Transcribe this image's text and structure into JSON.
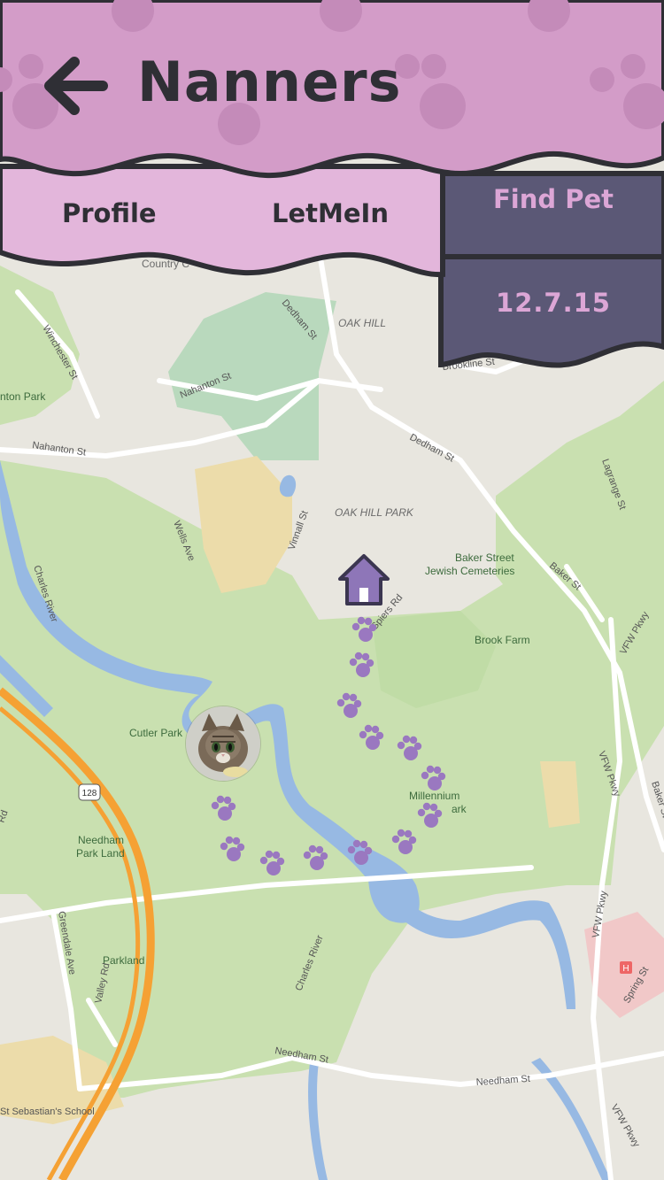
{
  "header": {
    "title": "Nanners",
    "back_icon": "arrow-left-icon",
    "bg_color": "#d39cc8"
  },
  "nav": {
    "tabs": [
      {
        "label": "Profile"
      },
      {
        "label": "LetMeIn"
      },
      {
        "label": "Find Pet"
      }
    ],
    "date": "12.7.15",
    "tab_bg_color": "#e3b6db",
    "active_bg_color": "#5b5876",
    "active_text_color": "#dca6d6"
  },
  "map": {
    "labels": {
      "country": "Country C",
      "oak_hill": "OAK HILL",
      "oak_hill_park": "OAK HILL PARK",
      "newton_park": "nton Park",
      "baker_street": "Baker Street",
      "jewish_cemeteries": "Jewish Cemeteries",
      "brook_farm": "Brook Farm",
      "cutler_park": "Cutler Park",
      "millennium": "Millennium",
      "park": "ark",
      "needham_park_land_1": "Needham",
      "needham_park_land_2": "Park Land",
      "parkland": "Parkland",
      "st_sebastians": "St Sebastian's School",
      "dedham_st_1": "Dedham St",
      "dedham_st_2": "Dedham St",
      "nahanton_st_1": "Nahanton St",
      "nahanton_st_2": "Nahanton St",
      "winchester_st": "Winchester St",
      "brookline_st": "Brookline St",
      "wells_ave": "Wells Ave",
      "vine_st": "Vinnall St",
      "spiers_rd": "Spiers Rd",
      "charles_river": "Charles River",
      "charles_river_2": "Charles River",
      "lagrange_st": "Lagrange St",
      "baker_st": "Baker St",
      "vfw_pkwy_1": "VFW Pkwy",
      "vfw_pkwy_2": "VFW Pkwy",
      "vfw_pkwy_3": "VFW Pkwy",
      "vfw_pkwy_4": "VFW Pkwy",
      "baker_st_2": "Baker St",
      "needham_st_1": "Needham St",
      "needham_st_2": "Needham St",
      "greendale_ave": "Greendale Ave",
      "valley_rd": "Valley Rd",
      "rd_left": "Rd",
      "spring_st": "Spring St",
      "route_128": "128"
    },
    "icons": {
      "home": "home-icon",
      "paw": "paw-print-icon",
      "pet_photo": "cat-avatar"
    }
  }
}
